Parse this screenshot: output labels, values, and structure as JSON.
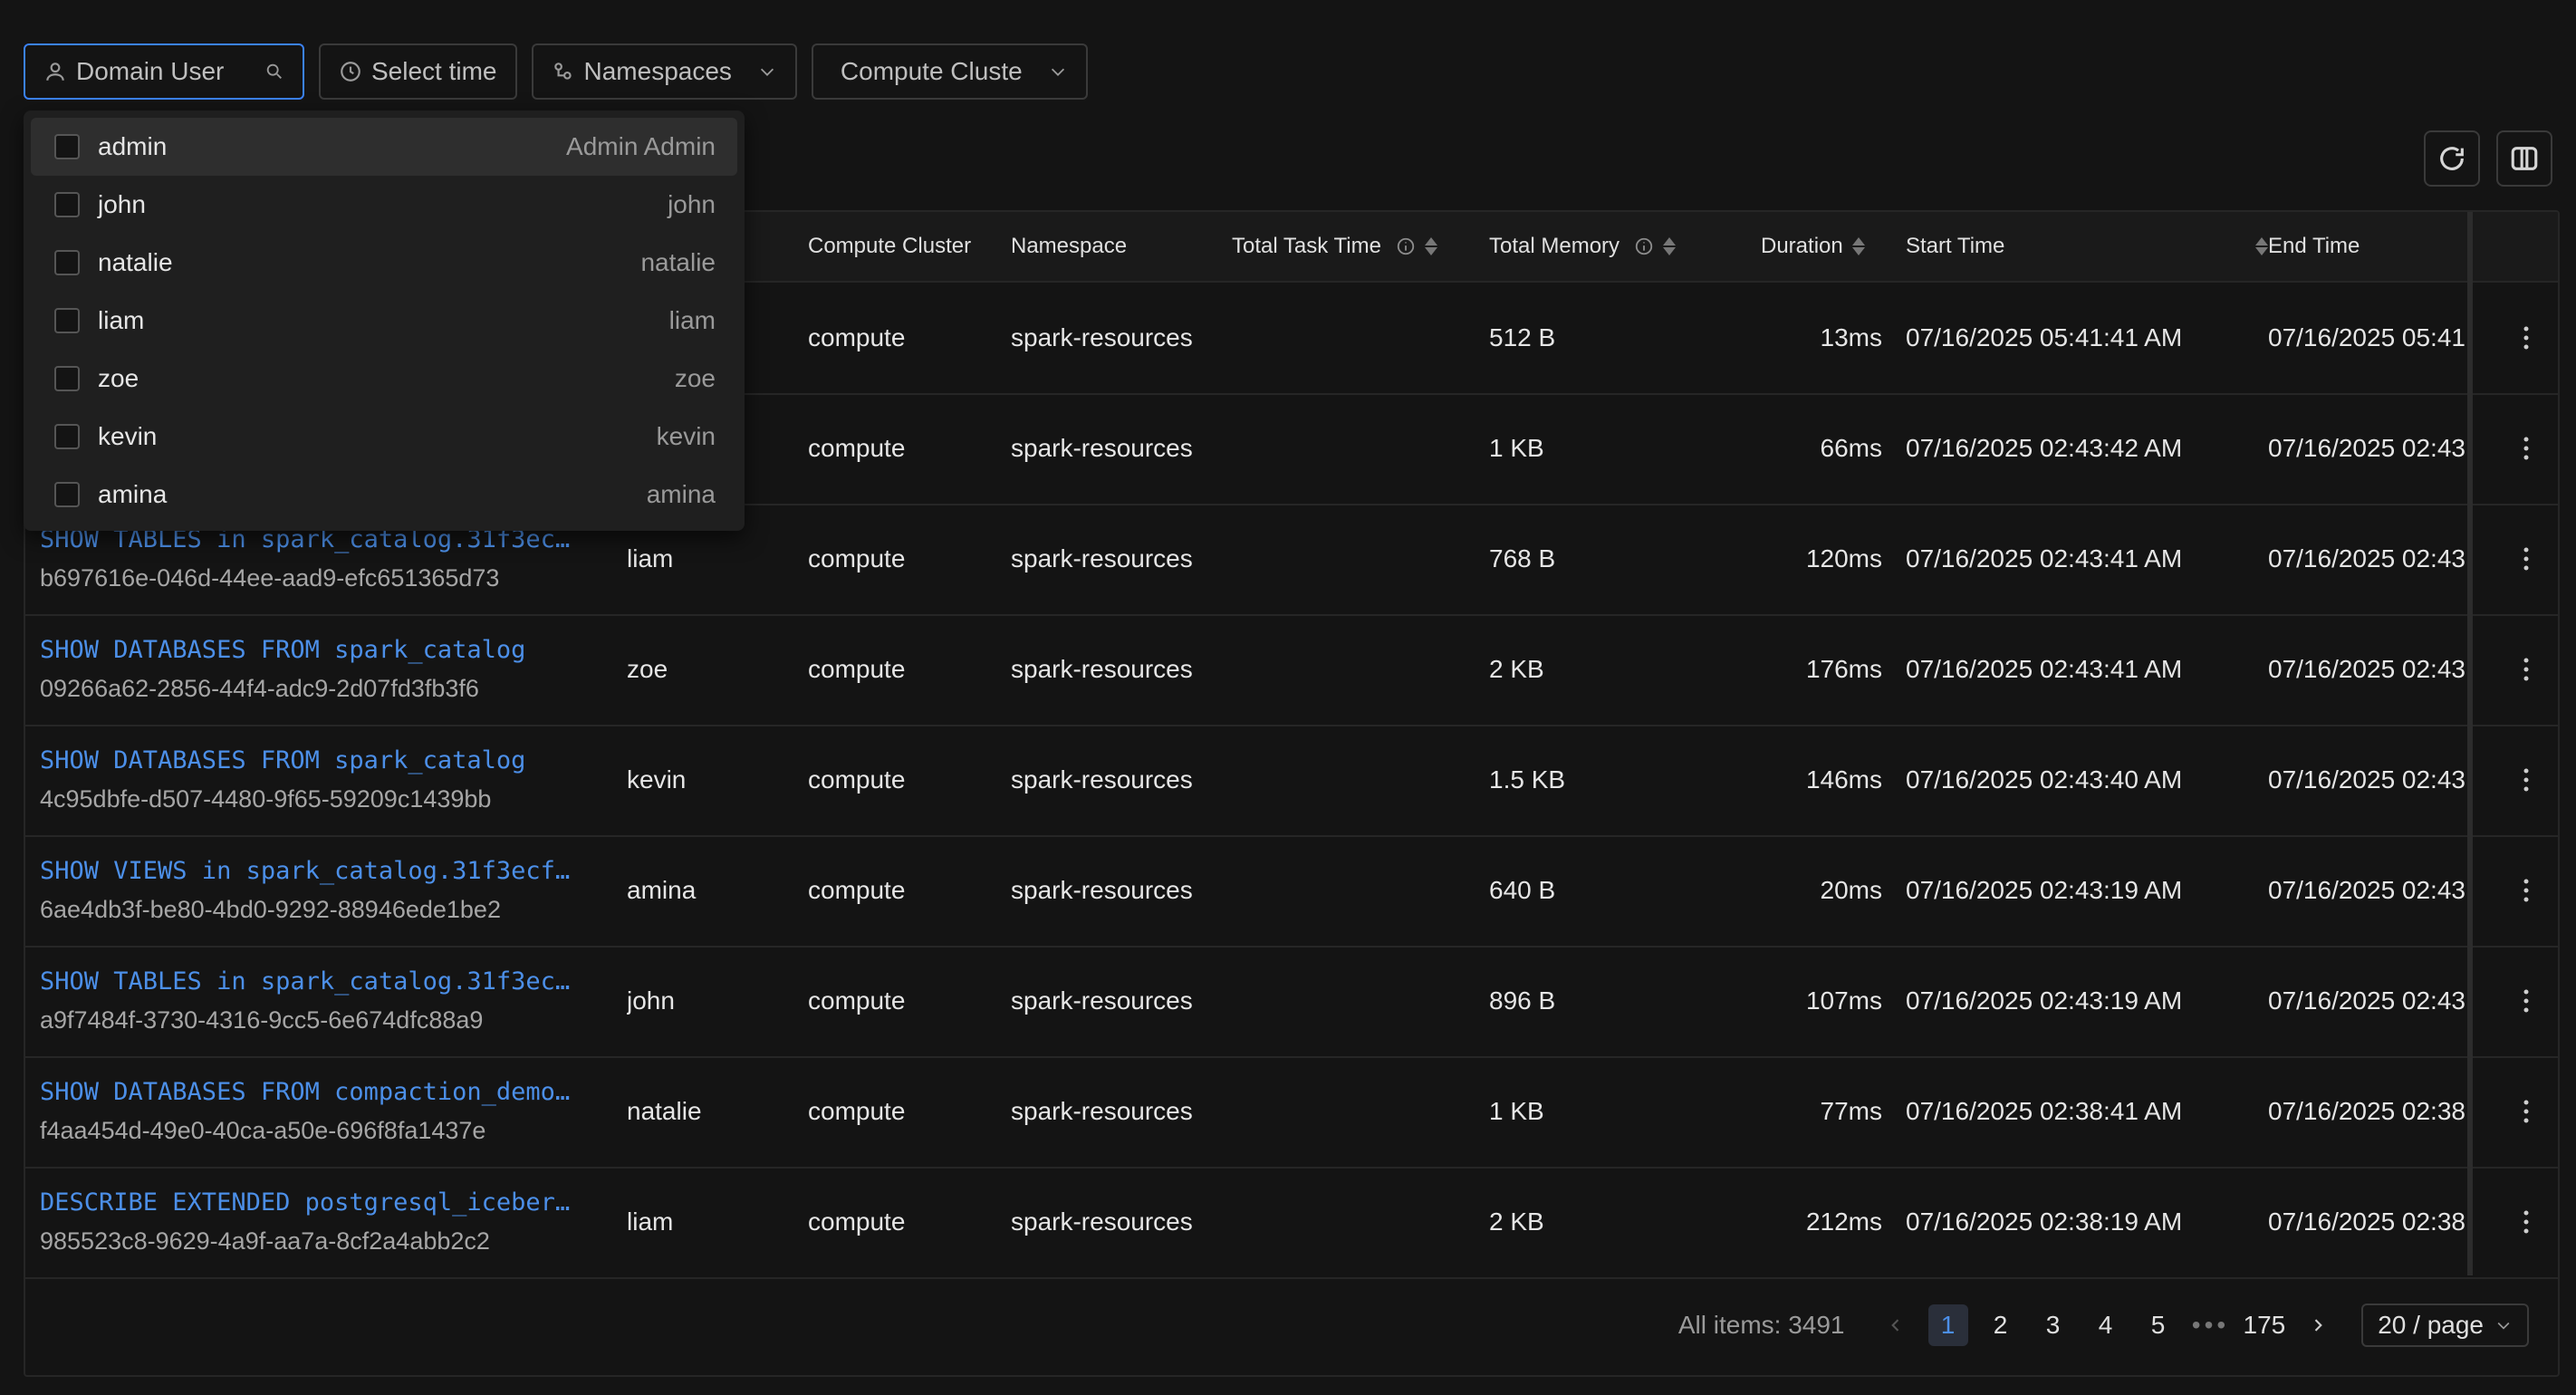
{
  "filters": {
    "domain_user_placeholder": "Domain User",
    "select_time_label": "Select time",
    "namespaces_label": "Namespaces",
    "compute_cluster_label": "Compute Cluste"
  },
  "user_options": [
    {
      "name": "admin",
      "display": "Admin Admin"
    },
    {
      "name": "john",
      "display": "john"
    },
    {
      "name": "natalie",
      "display": "natalie"
    },
    {
      "name": "liam",
      "display": "liam"
    },
    {
      "name": "zoe",
      "display": "zoe"
    },
    {
      "name": "kevin",
      "display": "kevin"
    },
    {
      "name": "amina",
      "display": "amina"
    }
  ],
  "columns": {
    "compute_cluster": "Compute Cluster",
    "namespace": "Namespace",
    "total_task_time": "Total Task Time",
    "total_memory": "Total Memory",
    "duration": "Duration",
    "start_time": "Start Time",
    "end_time": "End Time"
  },
  "rows": [
    {
      "query": "",
      "id": "",
      "user": "",
      "cluster": "compute",
      "namespace": "spark-resources",
      "task_time": "",
      "memory": "512 B",
      "duration": "13ms",
      "start": "07/16/2025 05:41:41 AM",
      "end": "07/16/2025 05:41"
    },
    {
      "query": "",
      "id": "",
      "user": "",
      "cluster": "compute",
      "namespace": "spark-resources",
      "task_time": "",
      "memory": "1 KB",
      "duration": "66ms",
      "start": "07/16/2025 02:43:42 AM",
      "end": "07/16/2025 02:43"
    },
    {
      "query": "SHOW TABLES in spark_catalog.31f3ec…",
      "id": "b697616e-046d-44ee-aad9-efc651365d73",
      "user": "liam",
      "cluster": "compute",
      "namespace": "spark-resources",
      "task_time": "",
      "memory": "768 B",
      "duration": "120ms",
      "start": "07/16/2025 02:43:41 AM",
      "end": "07/16/2025 02:43"
    },
    {
      "query": "SHOW DATABASES FROM spark_catalog",
      "id": "09266a62-2856-44f4-adc9-2d07fd3fb3f6",
      "user": "zoe",
      "cluster": "compute",
      "namespace": "spark-resources",
      "task_time": "",
      "memory": "2 KB",
      "duration": "176ms",
      "start": "07/16/2025 02:43:41 AM",
      "end": "07/16/2025 02:43"
    },
    {
      "query": "SHOW DATABASES FROM spark_catalog",
      "id": "4c95dbfe-d507-4480-9f65-59209c1439bb",
      "user": "kevin",
      "cluster": "compute",
      "namespace": "spark-resources",
      "task_time": "",
      "memory": "1.5 KB",
      "duration": "146ms",
      "start": "07/16/2025 02:43:40 AM",
      "end": "07/16/2025 02:43"
    },
    {
      "query": "SHOW VIEWS in spark_catalog.31f3ecf…",
      "id": "6ae4db3f-be80-4bd0-9292-88946ede1be2",
      "user": "amina",
      "cluster": "compute",
      "namespace": "spark-resources",
      "task_time": "",
      "memory": "640 B",
      "duration": "20ms",
      "start": "07/16/2025 02:43:19 AM",
      "end": "07/16/2025 02:43"
    },
    {
      "query": "SHOW TABLES in spark_catalog.31f3ec…",
      "id": "a9f7484f-3730-4316-9cc5-6e674dfc88a9",
      "user": "john",
      "cluster": "compute",
      "namespace": "spark-resources",
      "task_time": "",
      "memory": "896 B",
      "duration": "107ms",
      "start": "07/16/2025 02:43:19 AM",
      "end": "07/16/2025 02:43"
    },
    {
      "query": "SHOW DATABASES FROM compaction_demo…",
      "id": "f4aa454d-49e0-40ca-a50e-696f8fa1437e",
      "user": "natalie",
      "cluster": "compute",
      "namespace": "spark-resources",
      "task_time": "",
      "memory": "1 KB",
      "duration": "77ms",
      "start": "07/16/2025 02:38:41 AM",
      "end": "07/16/2025 02:38"
    },
    {
      "query": "DESCRIBE EXTENDED postgresql_iceber…",
      "id": "985523c8-9629-4a9f-aa7a-8cf2a4abb2c2",
      "user": "liam",
      "cluster": "compute",
      "namespace": "spark-resources",
      "task_time": "",
      "memory": "2 KB",
      "duration": "212ms",
      "start": "07/16/2025 02:38:19 AM",
      "end": "07/16/2025 02:38"
    }
  ],
  "pagination": {
    "total_label": "All items: 3491",
    "pages": [
      "1",
      "2",
      "3",
      "4",
      "5"
    ],
    "ellipsis": "•••",
    "last_page": "175",
    "page_size": "20 / page",
    "current": "1"
  },
  "colors": {
    "accent": "#4c8fe8",
    "background": "#141414",
    "border": "#262626"
  },
  "icons": [
    "user-icon",
    "search-icon",
    "clock-icon",
    "namespace-icon",
    "chevron-down-icon",
    "refresh-icon",
    "columns-icon",
    "info-icon",
    "sort-icon",
    "more-vertical-icon",
    "chevron-left-icon",
    "chevron-right-icon"
  ]
}
